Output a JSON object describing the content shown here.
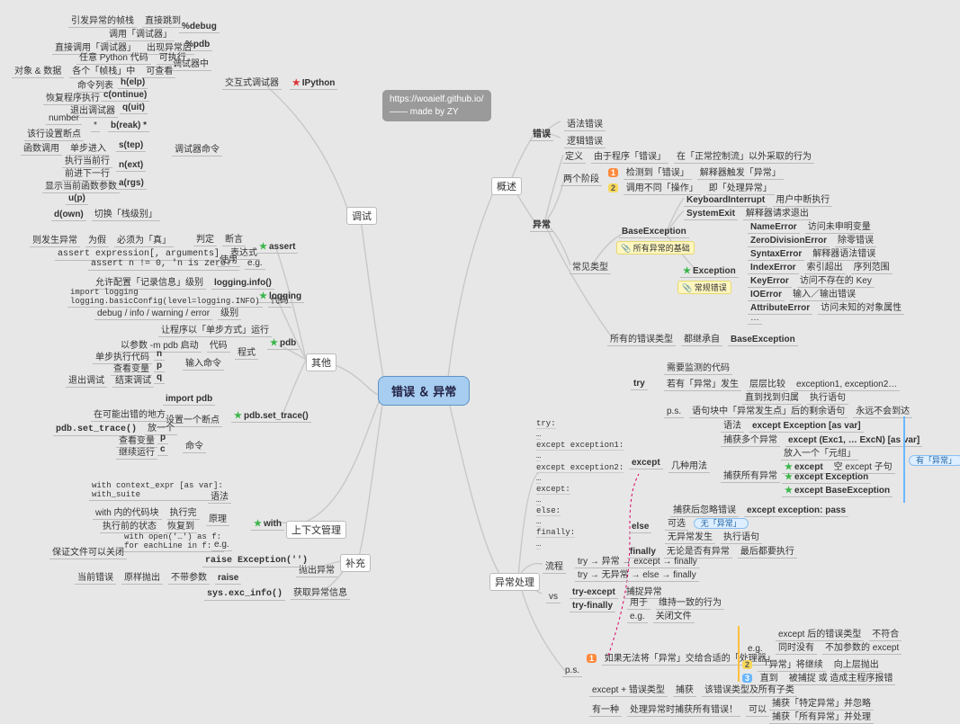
{
  "watermark": {
    "l1": "https://woaielf.github.io/",
    "l2": "—— made by ZY"
  },
  "root": "错误 ＆ 异常",
  "leftHubs": {
    "debug": "调试",
    "other": "其他",
    "ctx": "上下文管理",
    "supp": "补充"
  },
  "rightHubs": {
    "overview": "概述",
    "handle": "异常处理"
  },
  "overview": {
    "err": "错误",
    "err1": "语法错误",
    "err2": "逻辑错误",
    "exc": "异常",
    "def": "定义",
    "def1": "由于程序「错误」",
    "def2": "在「正常控制流」以外采取的行为",
    "stage": "两个阶段",
    "s1n": "1",
    "s1a": "检测到「错误」",
    "s1b": "解释器触发「异常」",
    "s2n": "2",
    "s2a": "调用不同「操作」",
    "s2b": "即「处理异常」",
    "types": "常见类型",
    "base": "BaseException",
    "baseNote": "📎 所有异常的基础",
    "ki": "KeyboardInterrupt",
    "kiD": "用户中断执行",
    "se": "SystemExit",
    "seD": "解释器请求退出",
    "ex": "Exception",
    "exNote": "📎 常规错误",
    "ne": "NameError",
    "neD": "访问未申明变量",
    "zde": "ZeroDivisionError",
    "zdeD": "除零错误",
    "syn": "SyntaxError",
    "synD": "解释器语法错误",
    "ie": "IndexError",
    "ieD": "索引超出",
    "ieD2": "序列范围",
    "ke": "KeyError",
    "keD": "访问不存在的 Key",
    "io": "IOError",
    "ioD": "输入／输出错误",
    "ae": "AttributeError",
    "aeD": "访问未知的对象属性",
    "dots": "…",
    "allA": "所有的错误类型",
    "allB": "都继承自",
    "allC": "BaseException"
  },
  "handle": {
    "codeLines": [
      "try:",
      "…",
      "except exception1:",
      "…",
      "except exception2:",
      "…",
      "except:",
      "…",
      "else:",
      "…",
      "finally:",
      "…"
    ],
    "try": "try",
    "tryA": "需要监测的代码",
    "tryB": "若有「异常」发生",
    "tryB1": "层层比较",
    "tryB1e": "exception1, exception2…",
    "tryB2": "直到找到归属",
    "tryB2e": "执行语句",
    "tryC": "p.s.",
    "tryC1": "语句块中「异常发生点」后的剩余语句",
    "tryC2": "永远不会到达",
    "except": "except",
    "exH": "几种用法",
    "exA": "语法",
    "exA1": "except Exception [as var]",
    "exB": "捕获多个异常",
    "exB1": "except (Exc1, … ExcN) [as var]",
    "exB2": "放入一个「元组」",
    "exC": "捕获所有异常",
    "exC1": "except",
    "exC1d": "空 except 子句",
    "exC2": "except Exception",
    "exC3": "except BaseException",
    "exD": "捕获后忽略错误",
    "exD1": "except exception: pass",
    "else": "else",
    "elseA": "可选",
    "elseAP": "无「异常」",
    "elseB": "无异常发生",
    "elseB1": "执行语句",
    "fin": "finally",
    "finA": "无论是否有异常",
    "finB": "最后都要执行",
    "flow": "流程",
    "flow1": "try → 异常 → except → finally",
    "flow2": "try → 无异常 → else → finally",
    "vs": "vs",
    "vsA": "try-except",
    "vsA1": "捕捉异常",
    "vsB": "try-finally",
    "vsB1": "用于",
    "vsB1a": "维持一致的行为",
    "vsB2": "e.g.",
    "vsB2a": "关闭文件",
    "ps": "p.s.",
    "psA1": "1",
    "psA1t": "如果无法将「异常」交给合适的「处理器」",
    "psAe": "e.g.",
    "psAe1": "except 后的错误类型",
    "psAe1b": "不符合",
    "psAe2": "同时没有",
    "psAe2b": "不加参数的 except",
    "psA2": "2",
    "psA2t": "「异常」将继续",
    "psA2b": "向上层抛出",
    "psA3": "3",
    "psA3t": "直到",
    "psA3b": "被捕捉 或 造成主程序报错",
    "psB": "except + 错误类型",
    "psB1": "捕获",
    "psB2": "该错误类型及所有子类",
    "psC": "有一种",
    "psC1": "处理异常时捕获所有错误！",
    "psC2": "可以",
    "psC3": "捕获「特定异常」并忽略",
    "psC4": "捕获「所有异常」并处理",
    "brace": "有「异常」"
  },
  "debug": {
    "pctdbg": "%debug",
    "d1a": "引发异常的帧栈",
    "d1b": "直接跳到",
    "d2": "调用「调试器」",
    "pctpdb": "%pdb",
    "p1a": "直接调用「调试器」",
    "p1b": "出现异常后",
    "dbgIn": "调试器中",
    "diA": "任意 Python 代码",
    "diA1": "可执行",
    "diB": "对象 & 数据",
    "diB1": "各个「帧栈」中",
    "diB2": "可查看",
    "inter": "交互式调试器",
    "ipy": "IPython",
    "cmd": "调试器命令",
    "c_help": "h(elp)",
    "c_help_d": "命令列表",
    "c_cont": "c(ontinue)",
    "c_cont_d": "恢复程序执行",
    "c_quit": "q(uit)",
    "c_quit_d": "退出调试器",
    "c_break": "b(reak) *",
    "c_break_d1": "number",
    "c_break_d2": "该行设置断点",
    "c_break_s": "*",
    "c_step": "s(tep)",
    "c_step_d1": "函数调用",
    "c_step_d2": "单步进入",
    "c_next": "n(ext)",
    "c_next_d1": "执行当前行",
    "c_next_d2": "前进下一行",
    "c_args": "a(rgs)",
    "c_args_d": "显示当前函数参数",
    "c_up": "u(p)",
    "c_down": "d(own)",
    "c_ud_d": "切换「栈级别」",
    "assert": "断言",
    "aH": "assert",
    "aJ": "判定",
    "aJ1": "则发生异常",
    "aJ2": "为假",
    "aJ3": "必须为「真」",
    "aUse": "使用",
    "aUseA": "assert expression[, arguments]",
    "aUseAd": "表达式",
    "aUseB": "assert n != 0, 'n is zero!'",
    "aUseBd": "e.g.",
    "log": "logging",
    "lgA": "允许配置「记录信息」级别",
    "lgA1": "logging.info()",
    "lgB": "import logging\\nlogging.basicConfig(level=logging.INFO)",
    "lgBd": "代码",
    "lgC": "debug / info / warning / error",
    "lgCd": "级别",
    "pdb": "pdb",
    "pdbA": "让程序以「单步方式」运行",
    "pdbMode": "程式",
    "pdbB": "以参数 -m pdb 启动",
    "pdbBd": "代码",
    "pdbIn": "输入命令",
    "pn": "n",
    "pnD": "单步执行代码",
    "pp": "p",
    "ppD": "查看变量",
    "pq": "q",
    "pqD": "退出调试",
    "pqD2": "结束调试",
    "trace": "pdb.set_trace()",
    "trA": "import pdb",
    "trH": "设置一个断点",
    "trB": "在可能出错的地方",
    "trC": "pdb.set_trace()",
    "trCd": "放一个",
    "trCmd": "命令",
    "trP": "p",
    "trPd": "查看变量",
    "trQ": "c",
    "trQd": "继续运行"
  },
  "supp": {
    "with": "with",
    "wSyn": "语法",
    "wSynC": "with context_expr [as var]:\\n    with_suite",
    "wPrin": "原理",
    "wA": "with 内的代码块",
    "wA1": "执行完",
    "wB": "执行前的状态",
    "wB1": "恢复到",
    "wEg": "e.g.",
    "wEgC": "with open('…') as f:\\n    for eachLine in f:",
    "wEgD": "保证文件可以关闭",
    "raise": "抛出异常",
    "rA": "raise Exception('')",
    "rB": "当前错误",
    "rB1": "原样抛出",
    "rB2": "不带参数",
    "rB3": "raise",
    "sys": "sys.exc_info()",
    "sysD": "获取异常信息"
  }
}
